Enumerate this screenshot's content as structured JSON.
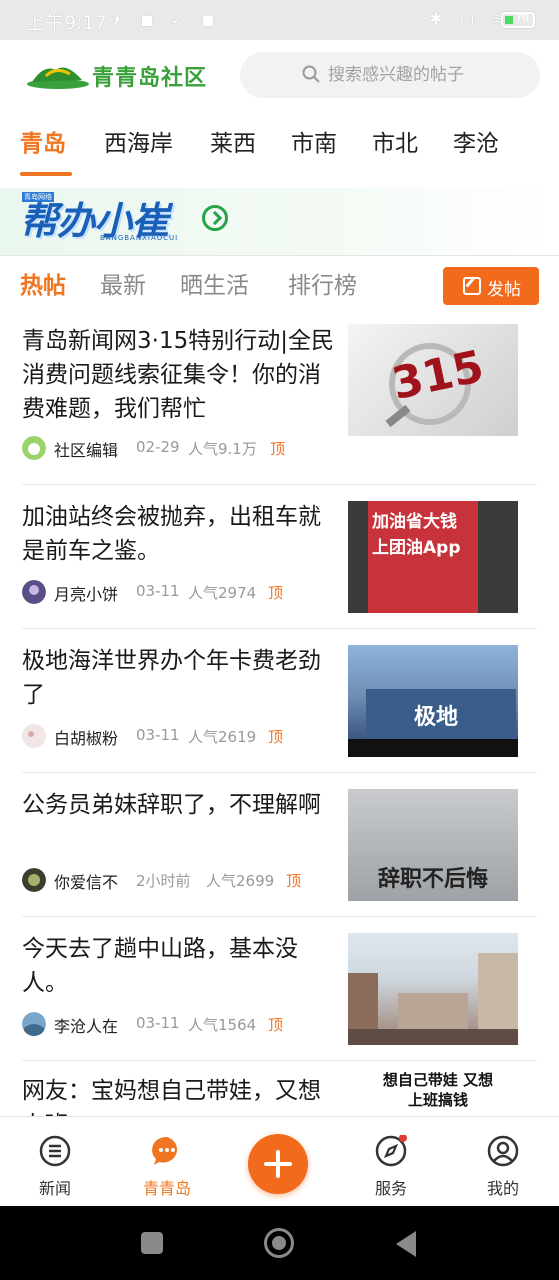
{
  "status_bar": {
    "time": "上午9:17",
    "left_icons": "✈ ◼ ✓ ◼ · ·",
    "right_icons": "✱ ıı ≋",
    "battery": "79"
  },
  "header": {
    "logo_text": "青青岛社区",
    "search_placeholder": "搜索感兴趣的帖子"
  },
  "city_tabs": [
    {
      "label": "青岛",
      "active": true
    },
    {
      "label": "西海岸"
    },
    {
      "label": "莱西"
    },
    {
      "label": "市南"
    },
    {
      "label": "市北"
    },
    {
      "label": "李沧"
    }
  ],
  "banner": {
    "title": "帮办小崔",
    "tag": "青岛网络",
    "subtitle": "BANGBANXIAOCUI"
  },
  "sub_tabs": [
    {
      "label": "热帖",
      "active": true
    },
    {
      "label": "最新"
    },
    {
      "label": "晒生活"
    },
    {
      "label": "排行榜"
    }
  ],
  "post_button": "发帖",
  "posts": [
    {
      "title": "青岛新闻网3·15特别行动|全民消费问题线索征集令！你的消费难题，我们帮忙",
      "author": "社区编辑",
      "date": "02-29",
      "hot": "人气9.1万",
      "top": "顶",
      "thumb_text": "315"
    },
    {
      "title": "加油站终会被抛弃，出租车就是前车之鉴。",
      "author": "月亮小饼",
      "date": "03-11",
      "hot": "人气2974",
      "top": "顶",
      "thumb_text": "加油省大钱 上团油App"
    },
    {
      "title": "极地海洋世界办个年卡费老劲了",
      "author": "白胡椒粉",
      "date": "03-11",
      "hot": "人气2619",
      "top": "顶",
      "thumb_text": "极地"
    },
    {
      "title": "公务员弟妹辞职了，不理解啊",
      "author": "你爱信不",
      "date": "2小时前",
      "hot": "人气2699",
      "top": "顶",
      "thumb_text": "辞职不后悔"
    },
    {
      "title": "今天去了趟中山路，基本没人。",
      "author": "李沧人在",
      "date": "03-11",
      "hot": "人气1564",
      "top": "顶",
      "thumb_text": ""
    },
    {
      "title": "网友：宝妈想自己带娃，又想上班",
      "author": "",
      "date": "",
      "hot": "",
      "top": "",
      "thumb_text": "想自己带娃 又想上班搞钱"
    }
  ],
  "bottom_nav": [
    {
      "label": "新闻",
      "icon": "menu-circle-icon"
    },
    {
      "label": "青青岛",
      "icon": "chat-bubble-icon",
      "active": true
    },
    {
      "label": "发布",
      "icon": "plus-icon"
    },
    {
      "label": "服务",
      "icon": "compass-icon"
    },
    {
      "label": "我的",
      "icon": "user-icon"
    }
  ],
  "colors": {
    "accent": "#f07520",
    "brand_green": "#3aa13a",
    "banner_blue": "#1a5fb8"
  }
}
